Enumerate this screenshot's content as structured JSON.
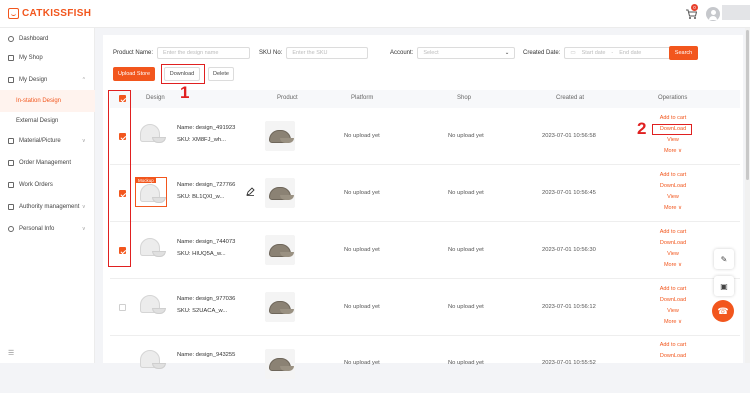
{
  "brand": {
    "name": "CATKISSFISH"
  },
  "header": {
    "cart_count": "0"
  },
  "sidebar": {
    "items": [
      {
        "label": "Dashboard",
        "icon": "clock-icon"
      },
      {
        "label": "My Shop",
        "icon": "shop-icon"
      },
      {
        "label": "My Design",
        "icon": "design-icon",
        "arrow": "^"
      },
      {
        "label": "In-station Design"
      },
      {
        "label": "External Design"
      },
      {
        "label": "Material/Picture",
        "icon": "image-icon",
        "arrow": "v"
      },
      {
        "label": "Order Management",
        "icon": "order-icon"
      },
      {
        "label": "Work Orders",
        "icon": "work-icon"
      },
      {
        "label": "Authority management",
        "icon": "lock-icon",
        "arrow": "v"
      },
      {
        "label": "Personal Info",
        "icon": "user-icon",
        "arrow": "v"
      }
    ],
    "collapse_glyph": "☰"
  },
  "filters": {
    "product_name_label": "Product Name:",
    "product_name_placeholder": "Enter the design name",
    "sku_label": "SKU No:",
    "sku_placeholder": "Enter the SKU",
    "account_label": "Account:",
    "account_placeholder": "Select",
    "created_label": "Created Date:",
    "start_placeholder": "Start date",
    "range_sep": "-",
    "end_placeholder": "End date",
    "search_label": "Search"
  },
  "toolbar": {
    "upload_label": "Upload Store",
    "download_label": "Download",
    "delete_label": "Delete"
  },
  "table": {
    "headers": {
      "design": "Design",
      "product": "Product",
      "platform": "Platform",
      "shop": "Shop",
      "created": "Created at",
      "operations": "Operations"
    },
    "rows": [
      {
        "name": "Name:  design_491923",
        "sku": "SKU:  XM8FJ_wh...",
        "platform": "No upload yet",
        "shop": "No upload yet",
        "created": "2023-07-01 10:56:58",
        "checked": true
      },
      {
        "name": "Name:  design_727766",
        "sku": "SKU:  BL1QXI_w...",
        "platform": "No upload yet",
        "shop": "No upload yet",
        "created": "2023-07-01 10:56:45",
        "checked": true,
        "mockup": "Mockup"
      },
      {
        "name": "Name:  design_744073",
        "sku": "SKU:  HIUQ5A_w...",
        "platform": "No upload yet",
        "shop": "No upload yet",
        "created": "2023-07-01 10:56:30",
        "checked": true
      },
      {
        "name": "Name:  design_977036",
        "sku": "SKU:  S2UACA_w...",
        "platform": "No upload yet",
        "shop": "No upload yet",
        "created": "2023-07-01 10:56:12",
        "checked": false
      },
      {
        "name": "Name:  design_943255",
        "sku": "",
        "platform": "No upload yet",
        "shop": "No upload yet",
        "created": "2023-07-01 10:55:52",
        "checked": false
      }
    ],
    "ops": {
      "add_to_cart": "Add to cart",
      "download": "DownLoad",
      "view": "View",
      "more": "More ∨"
    }
  },
  "annotations": {
    "one": "1",
    "two": "2"
  },
  "colors": {
    "accent": "#f2561d",
    "annotation": "#e02020"
  }
}
